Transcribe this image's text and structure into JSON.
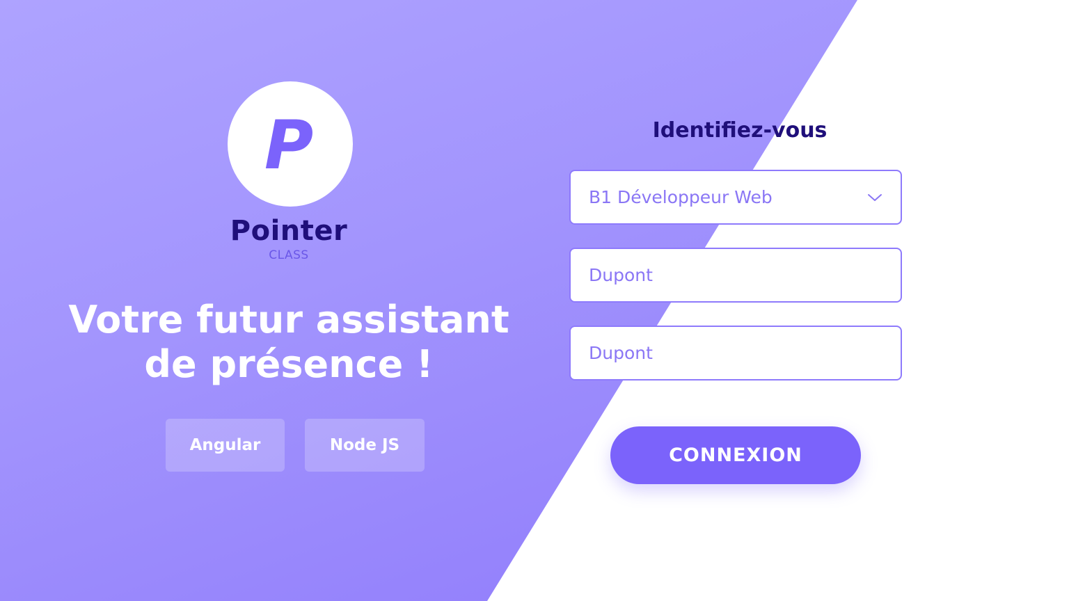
{
  "brand": {
    "logo_letter": "P",
    "name": "Pointer",
    "subname": "CLASS"
  },
  "hero": {
    "headline_line1": "Votre futur assistant",
    "headline_line2": "de présence !"
  },
  "tags": [
    {
      "label": "Angular"
    },
    {
      "label": "Node JS"
    }
  ],
  "form": {
    "title": "Identifiez-vous",
    "class_select": {
      "value": "B1 Développeur Web",
      "icon": "chevron-down-icon"
    },
    "last_name": {
      "placeholder": "Dupont"
    },
    "first_name": {
      "placeholder": "Dupont"
    },
    "submit_label": "CONNEXION"
  },
  "colors": {
    "accent": "#7b63fb",
    "brand_dark": "#1f0f7a",
    "field_border": "#8e7afc",
    "panel_light": "#aea3ff",
    "panel_dark": "#8d78fb"
  }
}
